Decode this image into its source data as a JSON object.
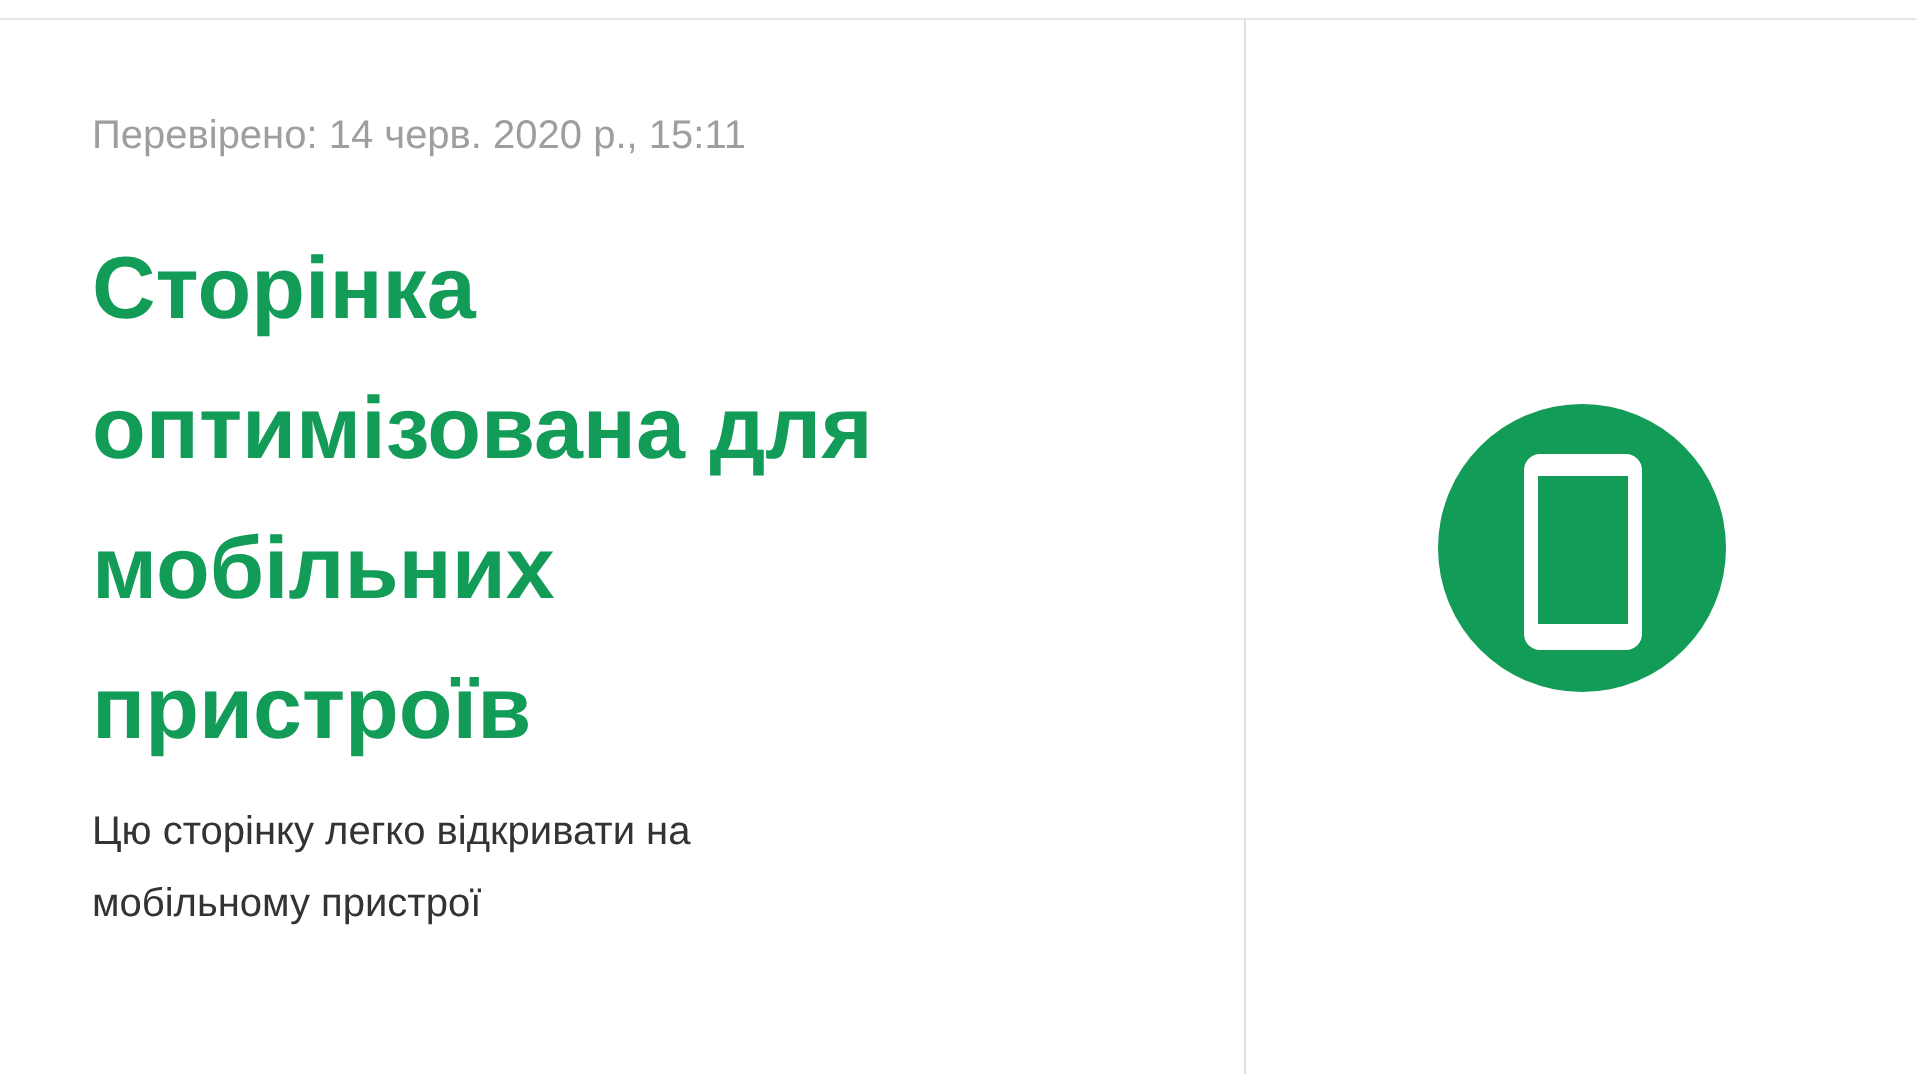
{
  "checked_date": "Перевірено: 14 черв. 2020 р., 15:11",
  "title": "Сторінка оптимізована для мобільних пристроїв",
  "description": "Цю сторінку легко відкривати на мобільному пристрої"
}
